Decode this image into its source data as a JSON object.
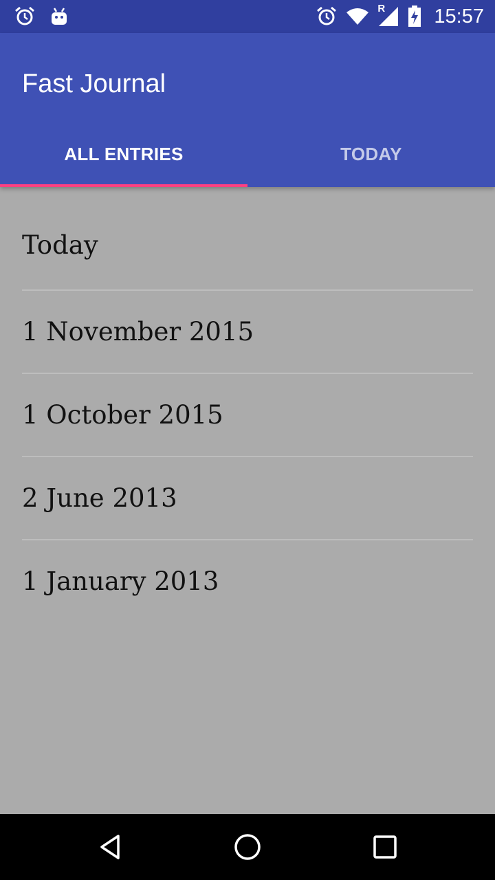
{
  "status_bar": {
    "time": "15:57",
    "left_icons": [
      "alarm-icon",
      "android-icon"
    ],
    "right_icons": [
      "alarm-icon",
      "wifi-icon",
      "cell-signal-roaming-icon",
      "battery-charging-icon"
    ],
    "roaming_label": "R"
  },
  "app_bar": {
    "title": "Fast Journal",
    "color": "#3f51b5"
  },
  "tabs": [
    {
      "label": "ALL ENTRIES",
      "selected": true
    },
    {
      "label": "TODAY",
      "selected": false
    }
  ],
  "accent_color": "#ff4081",
  "entries": [
    {
      "label": "Today"
    },
    {
      "label": "1 November 2015"
    },
    {
      "label": "1 October 2015"
    },
    {
      "label": "2 June 2013"
    },
    {
      "label": "1 January 2013"
    }
  ],
  "nav_bar": {
    "buttons": [
      "back-icon",
      "home-icon",
      "recents-icon"
    ]
  }
}
